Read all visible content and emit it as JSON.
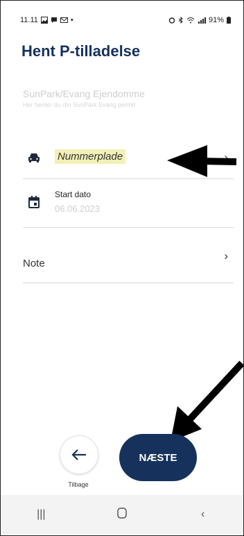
{
  "status_bar": {
    "time": "11.11",
    "battery": "91%"
  },
  "page": {
    "title": "Hent P-tilladelse"
  },
  "site": {
    "name": "SunPark/Evang Ejendomme",
    "subtitle": "Her henter du din SunPark Evang permit"
  },
  "form": {
    "plate_placeholder": "Nummerplade",
    "start_date_label": "Start dato",
    "start_date_value": "06.06.2023",
    "note_label": "Note"
  },
  "buttons": {
    "back_label": "Tilbage",
    "next_label": "NÆSTE"
  },
  "icons": {
    "car": "car-icon",
    "calendar": "calendar-icon",
    "chevron": "chevron-right-icon",
    "back": "arrow-left-icon"
  }
}
